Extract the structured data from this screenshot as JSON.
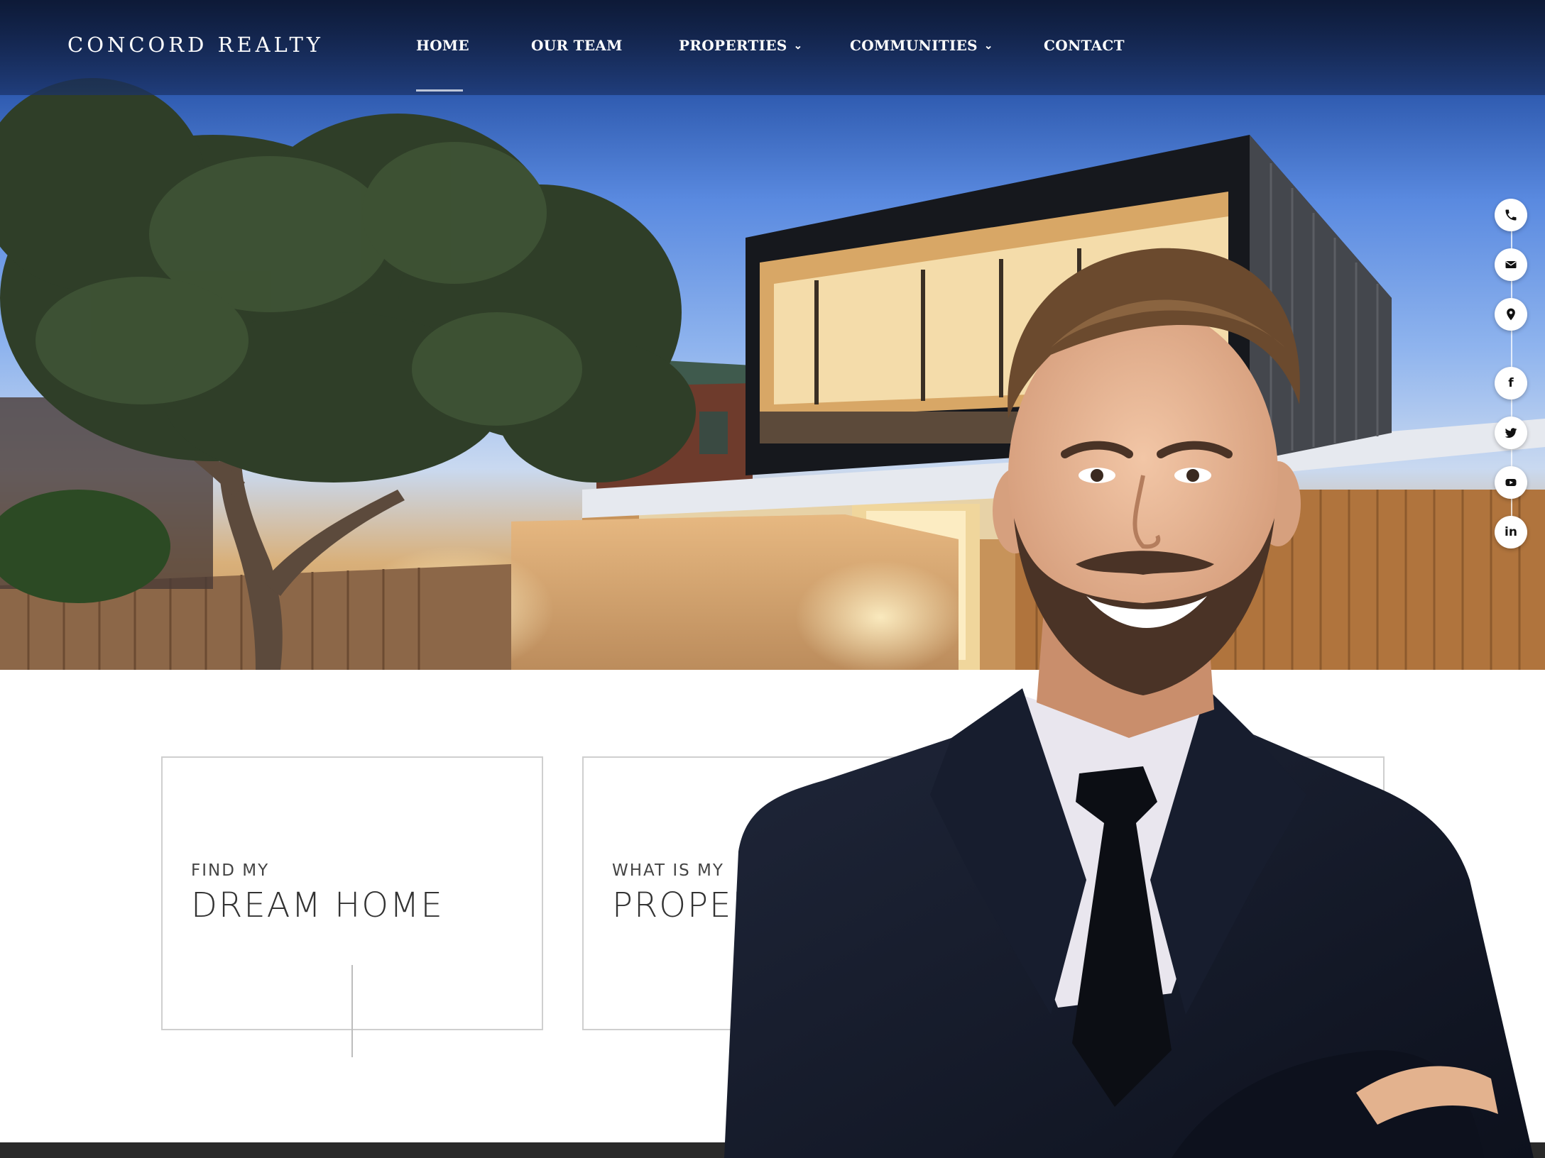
{
  "brand": {
    "name": "CONCORD REALTY"
  },
  "nav": {
    "items": [
      {
        "label": "HOME",
        "active": true,
        "has_dropdown": false
      },
      {
        "label": "OUR TEAM",
        "active": false,
        "has_dropdown": false
      },
      {
        "label": "PROPERTIES",
        "active": false,
        "has_dropdown": true
      },
      {
        "label": "COMMUNITIES",
        "active": false,
        "has_dropdown": true
      },
      {
        "label": "CONTACT",
        "active": false,
        "has_dropdown": false
      }
    ],
    "dropdown_icon": "chevron-down-icon"
  },
  "social": {
    "items": [
      {
        "icon": "phone-icon"
      },
      {
        "icon": "mail-icon"
      },
      {
        "icon": "location-pin-icon"
      },
      {
        "icon": "facebook-icon",
        "glyph": "f"
      },
      {
        "icon": "twitter-icon"
      },
      {
        "icon": "youtube-icon"
      },
      {
        "icon": "linkedin-icon",
        "glyph": "in"
      }
    ]
  },
  "cards": [
    {
      "kicker": "FIND MY",
      "headline": "DREAM HOME"
    },
    {
      "kicker": "WHAT IS MY",
      "headline": "PROPER"
    }
  ],
  "colors": {
    "nav_bg": "#13244c",
    "sky_top": "#2f5bb0",
    "card_border": "#cfcfcf",
    "suit": "#141a2c",
    "footer": "#2a2a2a"
  }
}
